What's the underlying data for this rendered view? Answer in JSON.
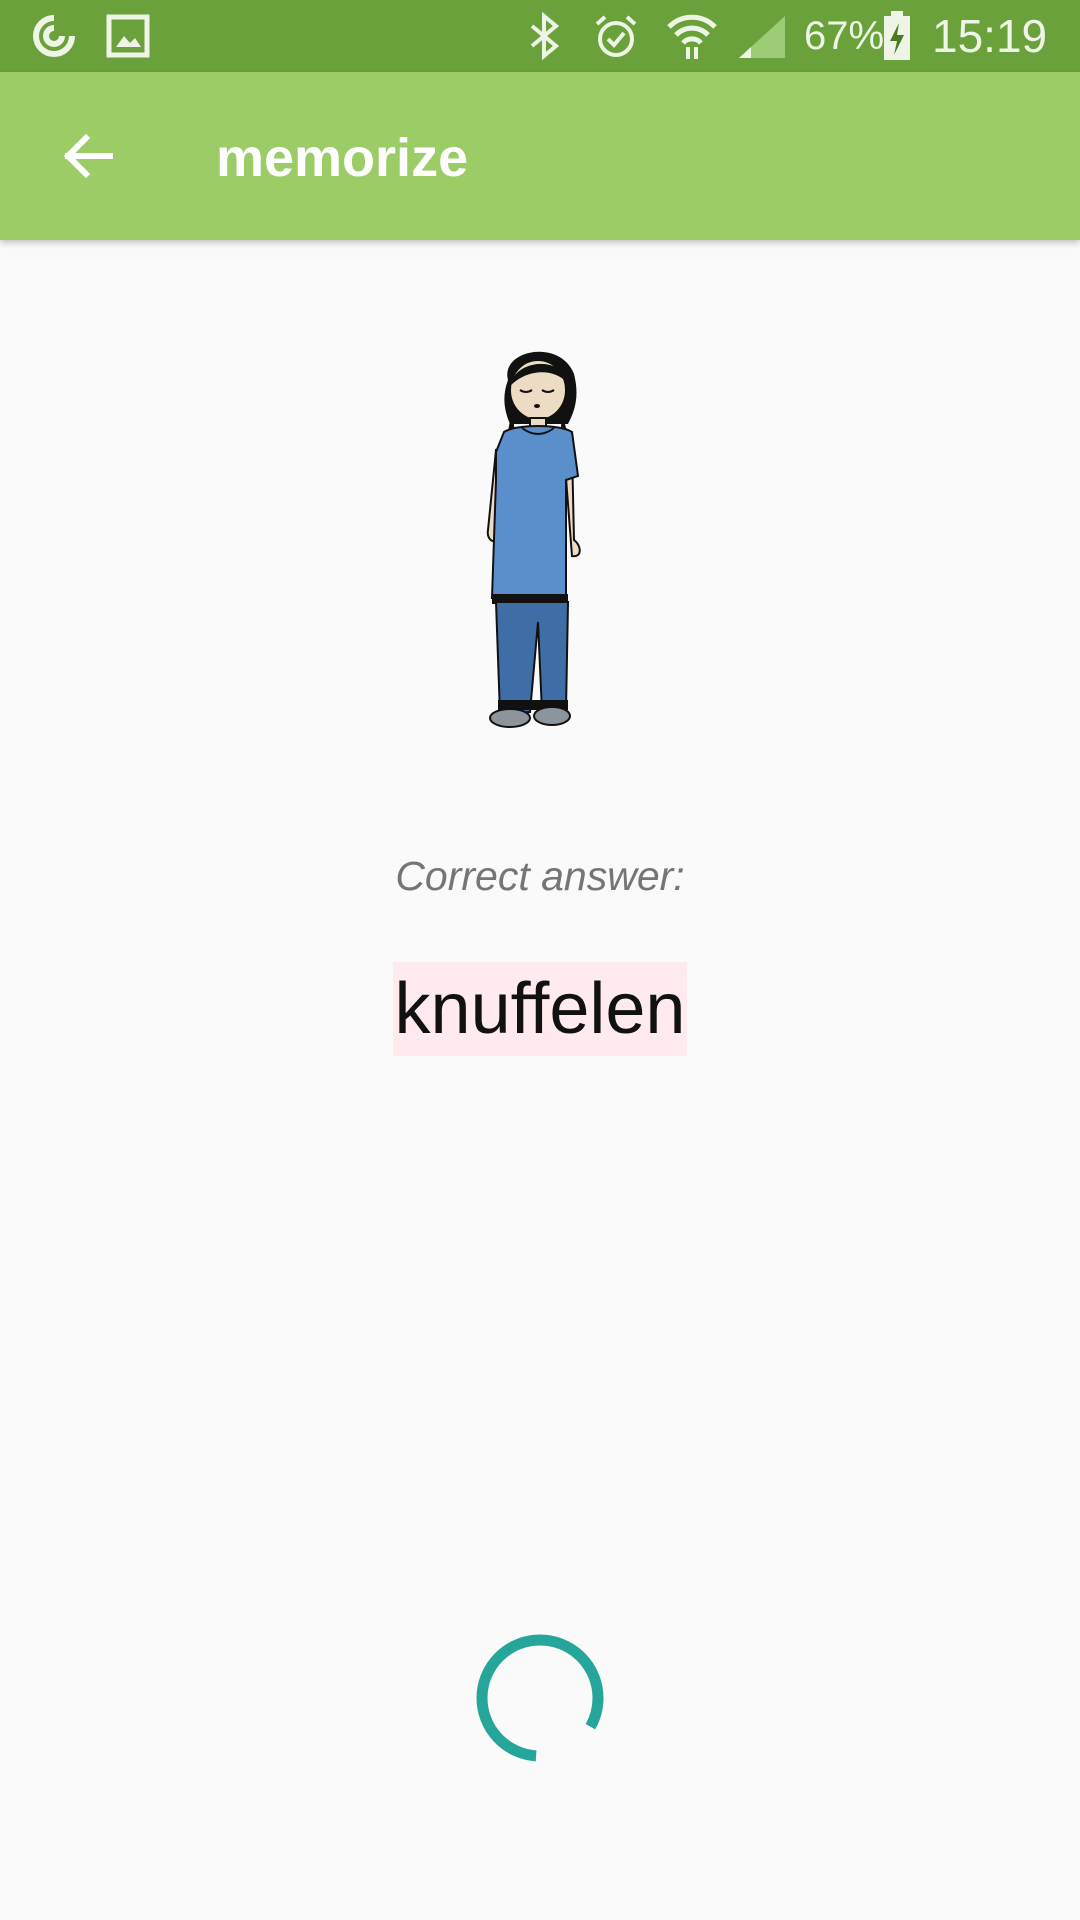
{
  "status_bar": {
    "battery_percent": "67%",
    "time": "15:19",
    "icons": [
      "sync-icon",
      "image-icon",
      "bluetooth-icon",
      "alarm-icon",
      "wifi-icon",
      "signal-icon",
      "battery-charging-icon"
    ]
  },
  "app_bar": {
    "title": "memorize",
    "back_icon": "arrow-left-icon"
  },
  "main": {
    "illustration": "girl-standing-figure",
    "prompt_label": "Correct answer:",
    "answer": "knuffelen"
  },
  "loading": {
    "icon": "loading-spinner",
    "color": "#26a69a"
  },
  "colors": {
    "status_bar": "#6aa13a",
    "app_bar": "#9ccc65",
    "answer_highlight": "#ffebee",
    "background": "#fafafa"
  }
}
